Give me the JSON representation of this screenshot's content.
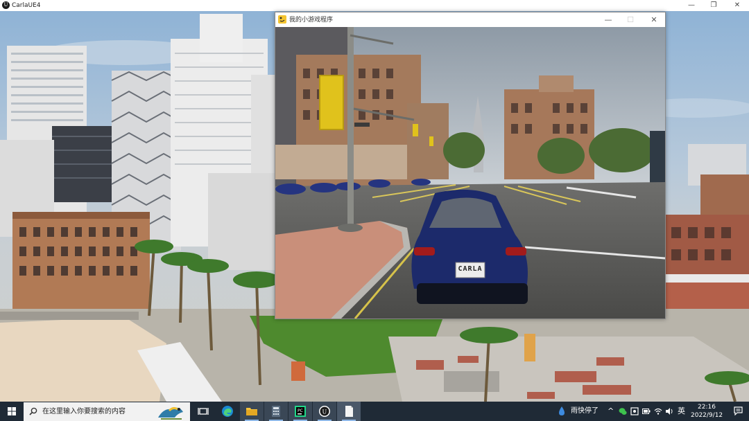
{
  "main_window": {
    "title": "CarlaUE4",
    "app_icon_letter": "U",
    "controls": {
      "minimize": "—",
      "maximize": "❐",
      "close": "✕"
    }
  },
  "game_window": {
    "title": "我的小游戏程序",
    "controls": {
      "minimize": "—",
      "maximize": "☐",
      "close": "✕"
    },
    "license_plate": "CARLA"
  },
  "taskbar": {
    "search_placeholder": "在这里输入你要搜索的内容",
    "apps": [
      "task-view",
      "edge",
      "file-explorer",
      "calculator",
      "pycharm",
      "unreal-engine",
      "notepad"
    ],
    "weather_text": "雨快停了",
    "ime_label": "英",
    "clock_time": "22:16",
    "clock_date": "2022/9/12"
  },
  "colors": {
    "taskbar_bg": "#1f2a36",
    "titlebar_bg": "#ffffff",
    "car_body": "#1c2a6b"
  }
}
